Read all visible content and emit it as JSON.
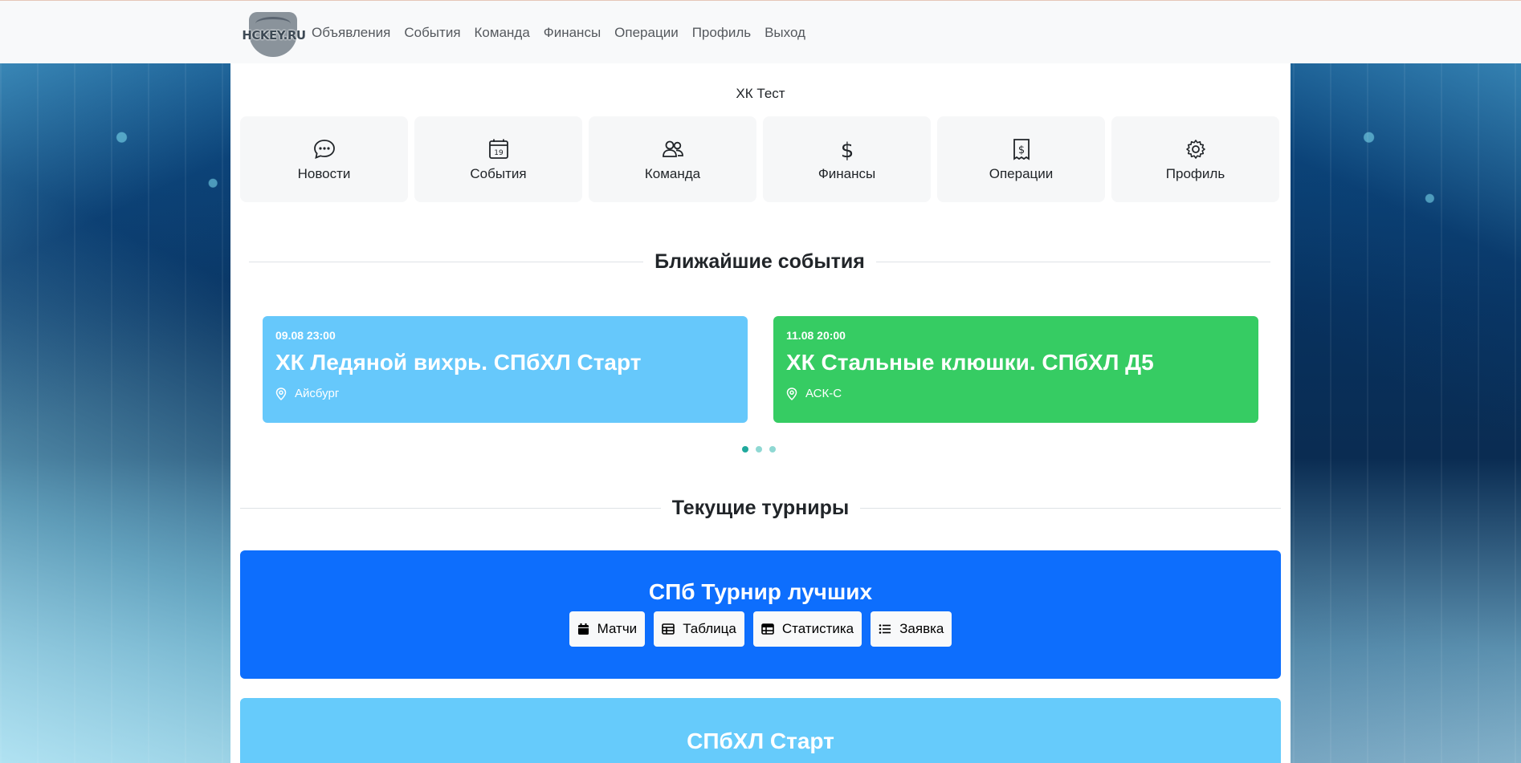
{
  "colors": {
    "nav_bg": "#f8f9fa",
    "event1_bg": "#66c8fb",
    "event2_bg": "#36cc63",
    "tournament1_bg": "#0d6efd",
    "tournament2_bg": "#66cbfb",
    "dot_active": "#20a99d"
  },
  "nav": {
    "logo_text": "HCKEY.RU",
    "links": [
      "Объявления",
      "События",
      "Команда",
      "Финансы",
      "Операции",
      "Профиль",
      "Выход"
    ]
  },
  "team_name": "ХК Тест",
  "tiles": [
    {
      "label": "Новости",
      "icon": "chat-dots-icon"
    },
    {
      "label": "События",
      "icon": "calendar-icon",
      "icon_text": "19"
    },
    {
      "label": "Команда",
      "icon": "people-icon"
    },
    {
      "label": "Финансы",
      "icon": "dollar-icon"
    },
    {
      "label": "Операции",
      "icon": "receipt-icon"
    },
    {
      "label": "Профиль",
      "icon": "gear-icon"
    }
  ],
  "upcoming": {
    "title": "Ближайшие события",
    "events": [
      {
        "date": "09.08 23:00",
        "title": "ХК Ледяной вихрь. СПбХЛ Старт",
        "place": "Айсбург"
      },
      {
        "date": "11.08 20:00",
        "title": "ХК Стальные клюшки. СПбХЛ Д5",
        "place": "АСК-С"
      }
    ],
    "carousel_pages": 3,
    "carousel_active": 1
  },
  "tournaments": {
    "title": "Текущие турниры",
    "items": [
      {
        "name": "СПб Турнир лучших",
        "buttons": [
          "Матчи",
          "Таблица",
          "Статистика",
          "Заявка"
        ]
      },
      {
        "name": "СПбХЛ Старт"
      }
    ]
  }
}
